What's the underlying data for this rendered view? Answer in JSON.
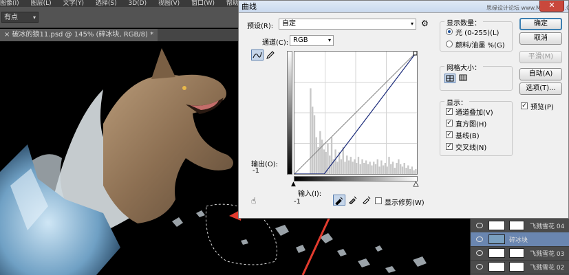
{
  "photoshop": {
    "menu": [
      "图像(I)",
      "图层(L)",
      "文字(Y)",
      "选择(S)",
      "3D(D)",
      "视图(V)",
      "窗口(W)",
      "帮助(H)"
    ],
    "option_select": "有点",
    "document_tab": "破冰的狼11.psd @ 145% (碎冰块, RGB/8) *"
  },
  "layers": [
    {
      "name": "飞溅雪花 04",
      "active": false
    },
    {
      "name": "碎冰块",
      "active": true
    },
    {
      "name": "飞溅雪花 03",
      "active": false
    },
    {
      "name": "飞溅雪花 02",
      "active": false
    }
  ],
  "dialog": {
    "title": "曲线",
    "preset_label": "预设(R):",
    "preset_value": "自定",
    "channel_label": "通道(C):",
    "channel_value": "RGB",
    "output_label": "输出(O):",
    "output_value": "-1",
    "input_label": "输入(I):",
    "input_value": "-1",
    "show_clipping": "显示修剪(W)",
    "display_amount": {
      "title": "显示数量：",
      "light": "光 (0-255)(L)",
      "pigment": "颜料/油墨 %(G)"
    },
    "grid_size_title": "网格大小：",
    "display": {
      "title": "显示：",
      "items": [
        "通道叠加(V)",
        "直方图(H)",
        "基线(B)",
        "交叉线(N)"
      ]
    },
    "buttons": {
      "ok": "确定",
      "cancel": "取消",
      "smooth": "平滑(M)",
      "auto": "自动(A)",
      "options": "选项(T)..."
    },
    "preview": "预览(P)",
    "curve": {
      "input_range": [
        0,
        255
      ],
      "baseline": [
        [
          0,
          0
        ],
        [
          255,
          255
        ]
      ],
      "points": [
        [
          62,
          0
        ],
        [
          255,
          255
        ]
      ]
    },
    "histogram": [
      0,
      0,
      0,
      0,
      0,
      0,
      0,
      0,
      70,
      55,
      48,
      30,
      22,
      35,
      28,
      20,
      18,
      25,
      15,
      30,
      12,
      20,
      10,
      18,
      12,
      22,
      10,
      15,
      11,
      14,
      10,
      12,
      9,
      14,
      8,
      12,
      9,
      11,
      8,
      10,
      7,
      10,
      8,
      12,
      6,
      11,
      7,
      9,
      6,
      14,
      8,
      10,
      5,
      9,
      12,
      8,
      6,
      9,
      5,
      7,
      4,
      6,
      3,
      4
    ]
  },
  "watermark": "思缘设计论坛 www.MISSYUAN.COM",
  "colors": {
    "dialog_bg": "#f0f0f0",
    "ps_panel": "#535353",
    "active_layer": "#6a86b0",
    "curve": "#1a2a7a",
    "arrow": "#e23b2e"
  }
}
